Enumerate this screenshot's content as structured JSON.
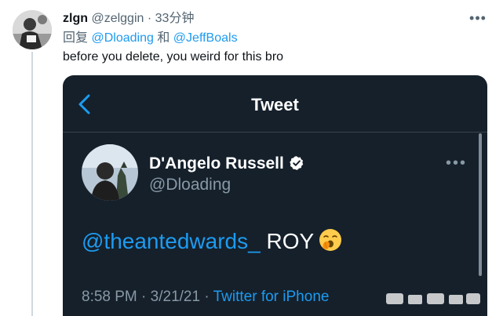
{
  "reply": {
    "author_name": "zlgn",
    "author_handle": "@zelggin",
    "separator": "·",
    "time": "33分钟",
    "reply_prefix": "回复",
    "reply_to_1": "@Dloading",
    "reply_joiner": "和",
    "reply_to_2": "@JeffBoals",
    "text": "before you delete, you weird for this bro",
    "more_icon": "more-horizontal-icon"
  },
  "embedded_screenshot": {
    "page_title": "Tweet",
    "back_icon": "chevron-left-icon",
    "author_name": "D'Angelo Russell",
    "verified_icon": "verified-badge-icon",
    "author_handle": "@Dloading",
    "body_mention": "@theantedwards_",
    "body_text": "ROY",
    "body_emoji": "yawning-face-emoji",
    "time": "8:58 PM",
    "meta_separator": "·",
    "date": "3/21/21",
    "source": "Twitter for iPhone"
  },
  "colors": {
    "link_blue": "#1d9bf0",
    "dark_background": "#15202b",
    "muted_gray": "#536471"
  }
}
